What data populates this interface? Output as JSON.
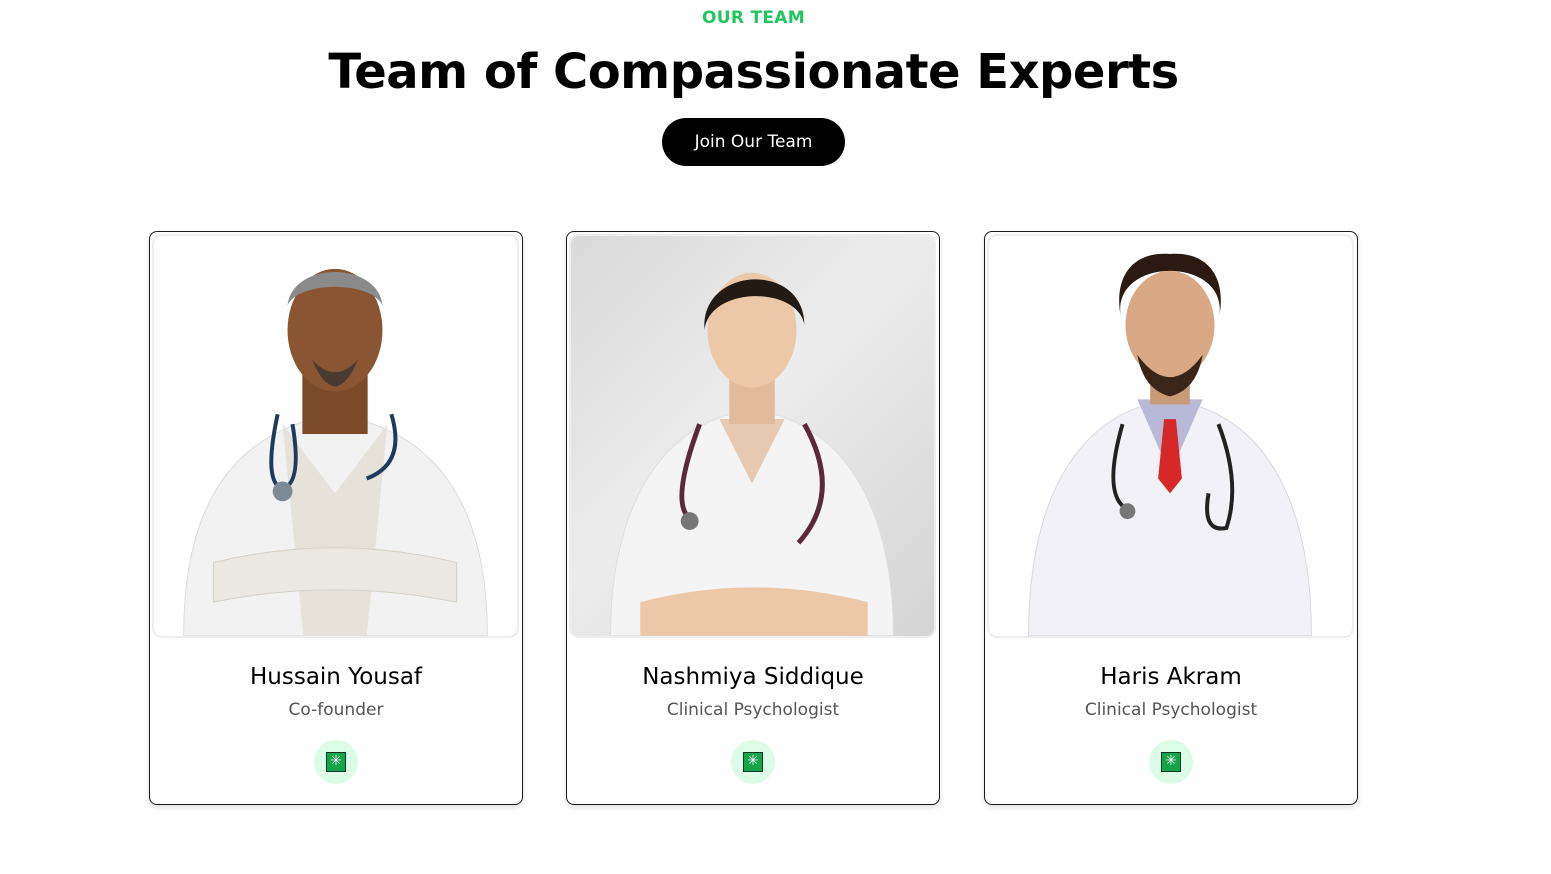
{
  "section": {
    "eyebrow": "OUR TEAM",
    "heading": "Team of Compassionate Experts",
    "join_button": "Join Our Team"
  },
  "team": [
    {
      "name": "Hussain Yousaf",
      "role": "Co-founder",
      "photo_bg": "#ffffff",
      "social_icon": "✳"
    },
    {
      "name": "Nashmiya Siddique",
      "role": "Clinical Psychologist",
      "photo_bg": "#dcdcdc",
      "social_icon": "✳"
    },
    {
      "name": "Haris Akram",
      "role": "Clinical Psychologist",
      "photo_bg": "#ffffff",
      "social_icon": "✳"
    }
  ],
  "colors": {
    "accent": "#22c55e",
    "button_bg": "#000000",
    "social_bg": "#dcfce7",
    "social_icon": "#16a34a"
  }
}
